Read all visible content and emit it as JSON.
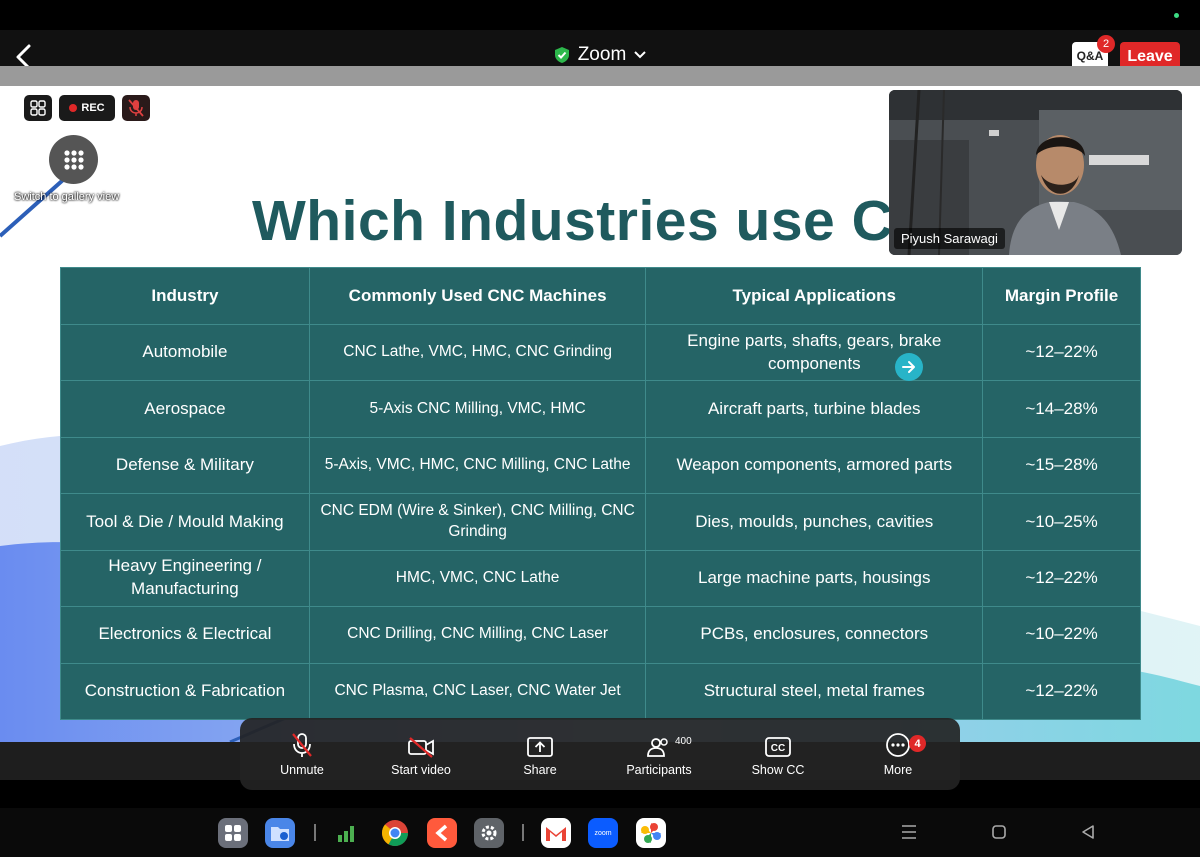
{
  "topbar": {
    "title": "Zoom",
    "qa_label": "Q&A",
    "qa_badge": "2",
    "leave_label": "Leave"
  },
  "overlay": {
    "rec_label": "REC",
    "gallery_label": "Switch to gallery view"
  },
  "video": {
    "participant_name": "Piyush Sarawagi"
  },
  "slide": {
    "title": "Which Industries use CI",
    "table": {
      "headers": [
        "Industry",
        "Commonly Used CNC Machines",
        "Typical Applications",
        "Margin Profile"
      ],
      "rows": [
        [
          "Automobile",
          "CNC Lathe, VMC, HMC, CNC Grinding",
          "Engine parts, shafts, gears, brake components",
          "~12–22%"
        ],
        [
          "Aerospace",
          "5-Axis CNC Milling, VMC, HMC",
          "Aircraft parts, turbine blades",
          "~14–28%"
        ],
        [
          "Defense & Military",
          "5-Axis, VMC, HMC, CNC Milling, CNC Lathe",
          "Weapon components, armored parts",
          "~15–28%"
        ],
        [
          "Tool & Die / Mould Making",
          "CNC EDM (Wire & Sinker), CNC Milling, CNC Grinding",
          "Dies, moulds, punches, cavities",
          "~10–25%"
        ],
        [
          "Heavy Engineering / Manufacturing",
          "HMC, VMC, CNC Lathe",
          "Large machine parts, housings",
          "~12–22%"
        ],
        [
          "Electronics & Electrical",
          "CNC Drilling, CNC Milling, CNC Laser",
          "PCBs, enclosures, connectors",
          "~10–22%"
        ],
        [
          "Construction & Fabrication",
          "CNC Plasma, CNC Laser, CNC Water Jet",
          "Structural steel, metal frames",
          "~12–22%"
        ]
      ]
    }
  },
  "controls": {
    "unmute": "Unmute",
    "start_video": "Start video",
    "share": "Share",
    "participants": "Participants",
    "participants_count": "400",
    "show_cc": "Show CC",
    "more": "More",
    "more_badge": "4"
  },
  "dock": {
    "zoom_label": "zoom"
  },
  "colors": {
    "accent_teal": "#256466",
    "title_teal": "#1f5a5e",
    "leave_red": "#e02828",
    "shield_green": "#2db84c"
  }
}
